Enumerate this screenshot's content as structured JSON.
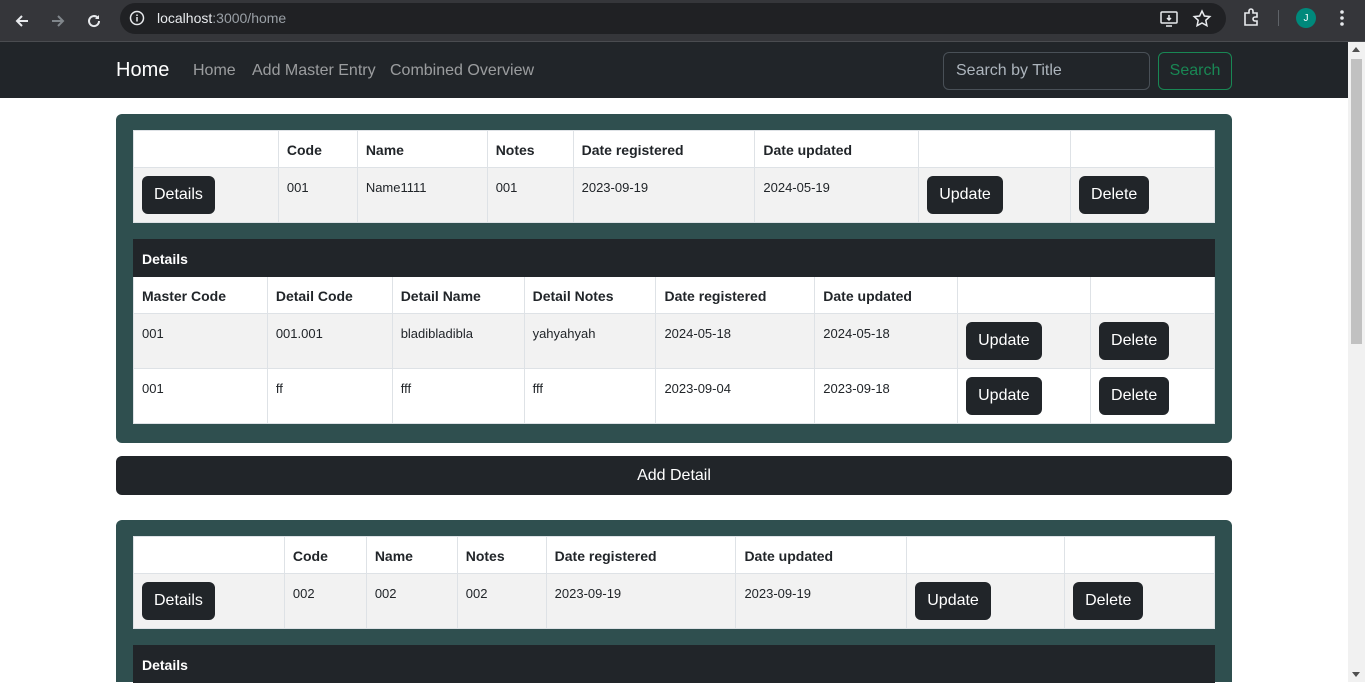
{
  "browser": {
    "url_host": "localhost",
    "url_path": ":3000/home",
    "avatar_letter": "J"
  },
  "navbar": {
    "brand": "Home",
    "links": [
      "Home",
      "Add Master Entry",
      "Combined Overview"
    ],
    "search_placeholder": "Search by Title",
    "search_button": "Search"
  },
  "masters": [
    {
      "headers": [
        "",
        "Code",
        "Name",
        "Notes",
        "Date registered",
        "Date updated",
        "",
        ""
      ],
      "row": {
        "details_label": "Details",
        "code": "001",
        "name": "Name1111",
        "notes": "001",
        "date_registered": "2023-09-19",
        "date_updated": "2024-05-19",
        "update_label": "Update",
        "delete_label": "Delete"
      },
      "details_title": "Details",
      "detail_headers": [
        "Master Code",
        "Detail Code",
        "Detail Name",
        "Detail Notes",
        "Date registered",
        "Date updated",
        "",
        ""
      ],
      "detail_rows": [
        {
          "master_code": "001",
          "detail_code": "001.001",
          "detail_name": "bladibladibla",
          "detail_notes": "yahyahyah",
          "date_registered": "2024-05-18",
          "date_updated": "2024-05-18",
          "update_label": "Update",
          "delete_label": "Delete"
        },
        {
          "master_code": "001",
          "detail_code": "ff",
          "detail_name": "fff",
          "detail_notes": "fff",
          "date_registered": "2023-09-04",
          "date_updated": "2023-09-18",
          "update_label": "Update",
          "delete_label": "Delete"
        }
      ],
      "add_detail_label": "Add Detail"
    },
    {
      "headers": [
        "",
        "Code",
        "Name",
        "Notes",
        "Date registered",
        "Date updated",
        "",
        ""
      ],
      "row": {
        "details_label": "Details",
        "code": "002",
        "name": "002",
        "notes": "002",
        "date_registered": "2023-09-19",
        "date_updated": "2023-09-19",
        "update_label": "Update",
        "delete_label": "Delete"
      },
      "details_title": "Details"
    }
  ],
  "colors": {
    "card_bg": "#2f4f4f",
    "navbar_bg": "#212529",
    "button_bg": "#212529",
    "search_green": "#198754"
  }
}
